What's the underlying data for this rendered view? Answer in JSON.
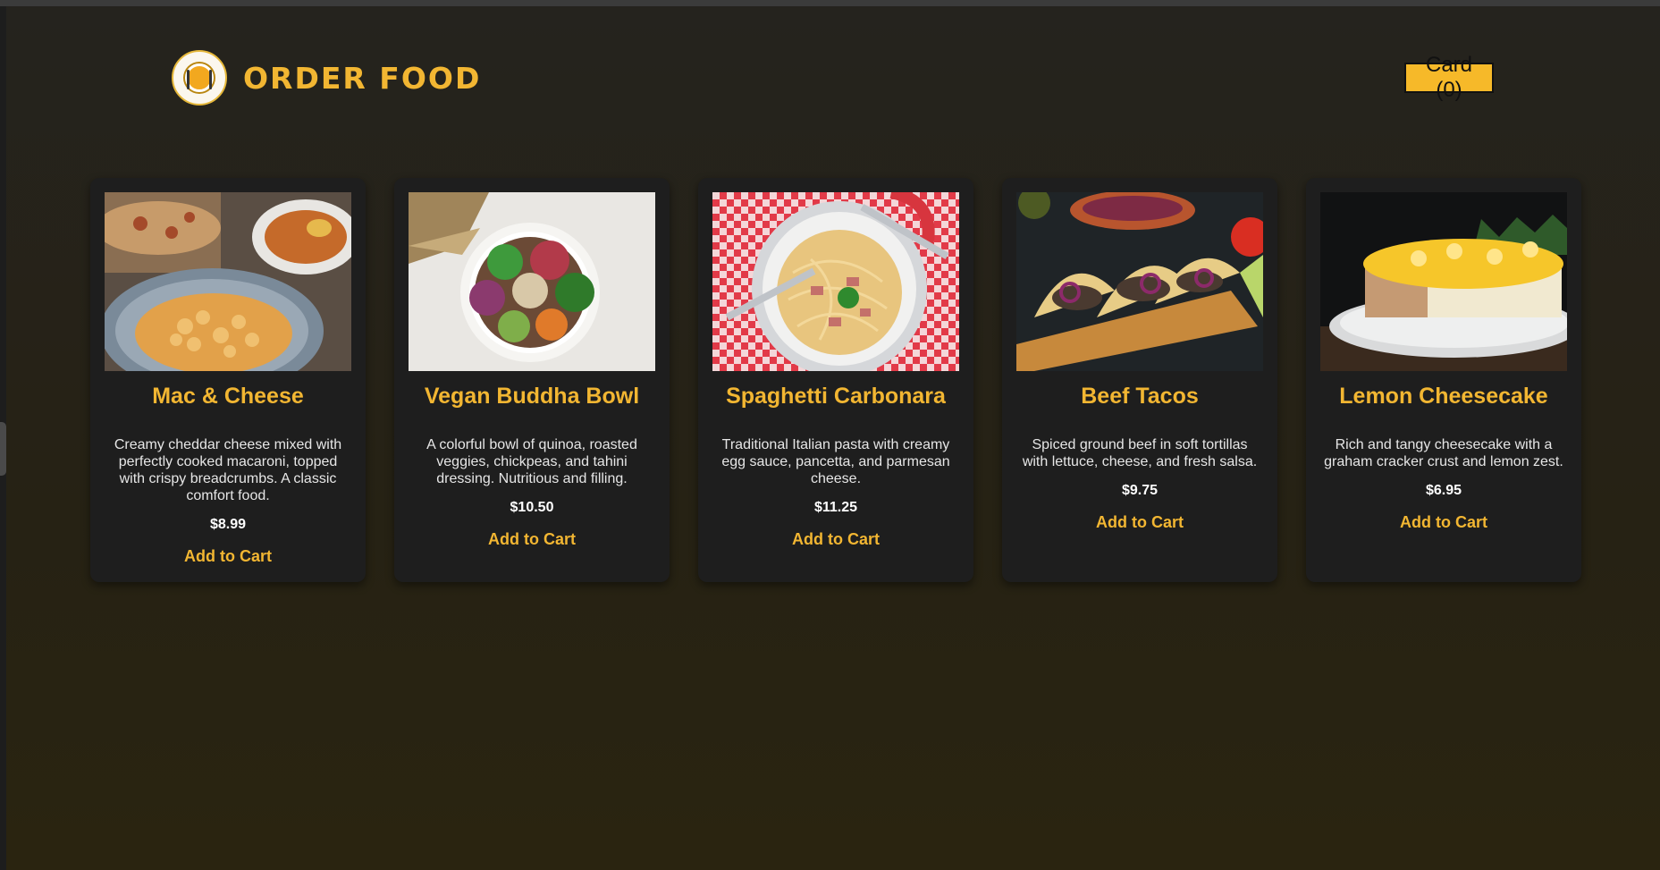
{
  "header": {
    "brand": "ORDER FOOD",
    "logo_icon": "plate-fork-knife-logo",
    "cart_label": "Card (0)"
  },
  "colors": {
    "accent": "#f2b632",
    "cart_button": "#f6b929",
    "card_bg": "#1e1e1e",
    "page_bg": "#262214"
  },
  "menu": {
    "items": [
      {
        "name": "Mac & Cheese",
        "description": "Creamy cheddar cheese mixed with perfectly cooked macaroni, topped with crispy breadcrumbs. A classic comfort food.",
        "price": "$8.99",
        "button": "Add to Cart",
        "image": "mac-and-cheese-photo"
      },
      {
        "name": "Vegan Buddha Bowl",
        "description": "A colorful bowl of quinoa, roasted veggies, chickpeas, and tahini dressing. Nutritious and filling.",
        "price": "$10.50",
        "button": "Add to Cart",
        "image": "buddha-bowl-photo"
      },
      {
        "name": "Spaghetti Carbonara",
        "description": "Traditional Italian pasta with creamy egg sauce, pancetta, and parmesan cheese.",
        "price": "$11.25",
        "button": "Add to Cart",
        "image": "spaghetti-carbonara-photo"
      },
      {
        "name": "Beef Tacos",
        "description": "Spiced ground beef in soft tortillas with lettuce, cheese, and fresh salsa.",
        "price": "$9.75",
        "button": "Add to Cart",
        "image": "beef-tacos-photo"
      },
      {
        "name": "Lemon Cheesecake",
        "description": "Rich and tangy cheesecake with a graham cracker crust and lemon zest.",
        "price": "$6.95",
        "button": "Add to Cart",
        "image": "lemon-cheesecake-photo"
      }
    ]
  }
}
